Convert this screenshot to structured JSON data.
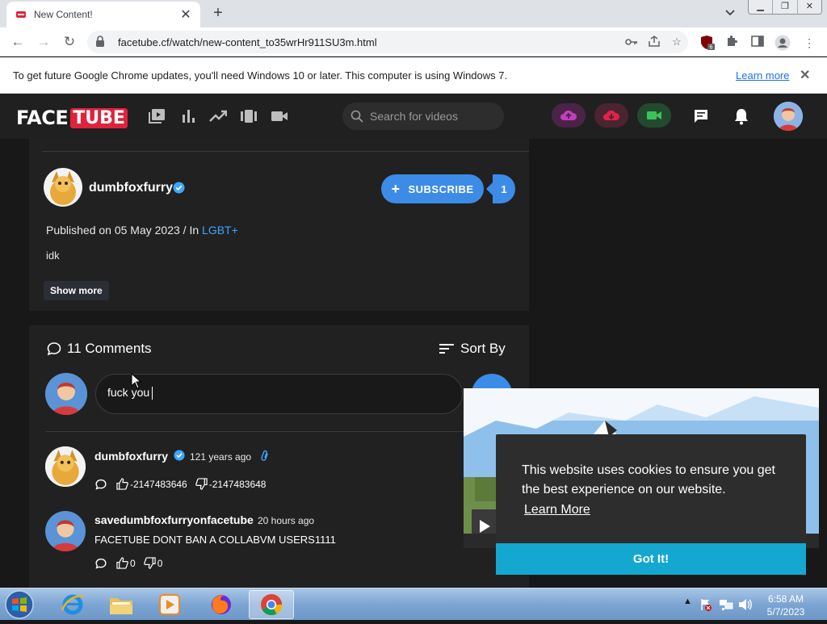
{
  "browser": {
    "tab_title": "New Content!",
    "url": "facetube.cf/watch/new-content_to35wrHr911SU3m.html",
    "extension_badge": "6"
  },
  "infobar": {
    "message": "To get future Google Chrome updates, you'll need Windows 10 or later. This computer is using Windows 7.",
    "learn_more": "Learn more"
  },
  "site": {
    "logo_face": "FACE",
    "logo_tube": "TUBE",
    "search_placeholder": "Search for videos"
  },
  "channel": {
    "name": "dumbfoxfurry",
    "subscribe_label": "SUBSCRIBE",
    "subscriber_count": "1",
    "published_prefix": "Published on 05 May 2023 / In ",
    "category": "LGBT+",
    "description": "idk",
    "show_more": "Show more"
  },
  "comments": {
    "title": "11 Comments",
    "sort_label": "Sort By",
    "draft": "fuck you",
    "items": [
      {
        "user": "dumbfoxfurry",
        "time": "121 years ago",
        "text": "",
        "likes": "-2147483646",
        "dislikes": "-2147483648"
      },
      {
        "user": "savedumbfoxfurryonfacetube",
        "time": "20 hours ago",
        "text": "FACETUBE DONT BAN A COLLABVM USERS1111",
        "likes": "0",
        "dislikes": "0"
      }
    ]
  },
  "cookie": {
    "message": "This website uses cookies to ensure you get the best experience on our website.",
    "learn_more": "Learn More",
    "accept": "Got It!"
  },
  "taskbar": {
    "time": "6:58 AM",
    "date": "5/7/2023"
  },
  "colors": {
    "accent": "#3c8ce7",
    "brand_red": "#e0223a",
    "link": "#3ea6ff",
    "cookie_button": "#14a7d0"
  }
}
